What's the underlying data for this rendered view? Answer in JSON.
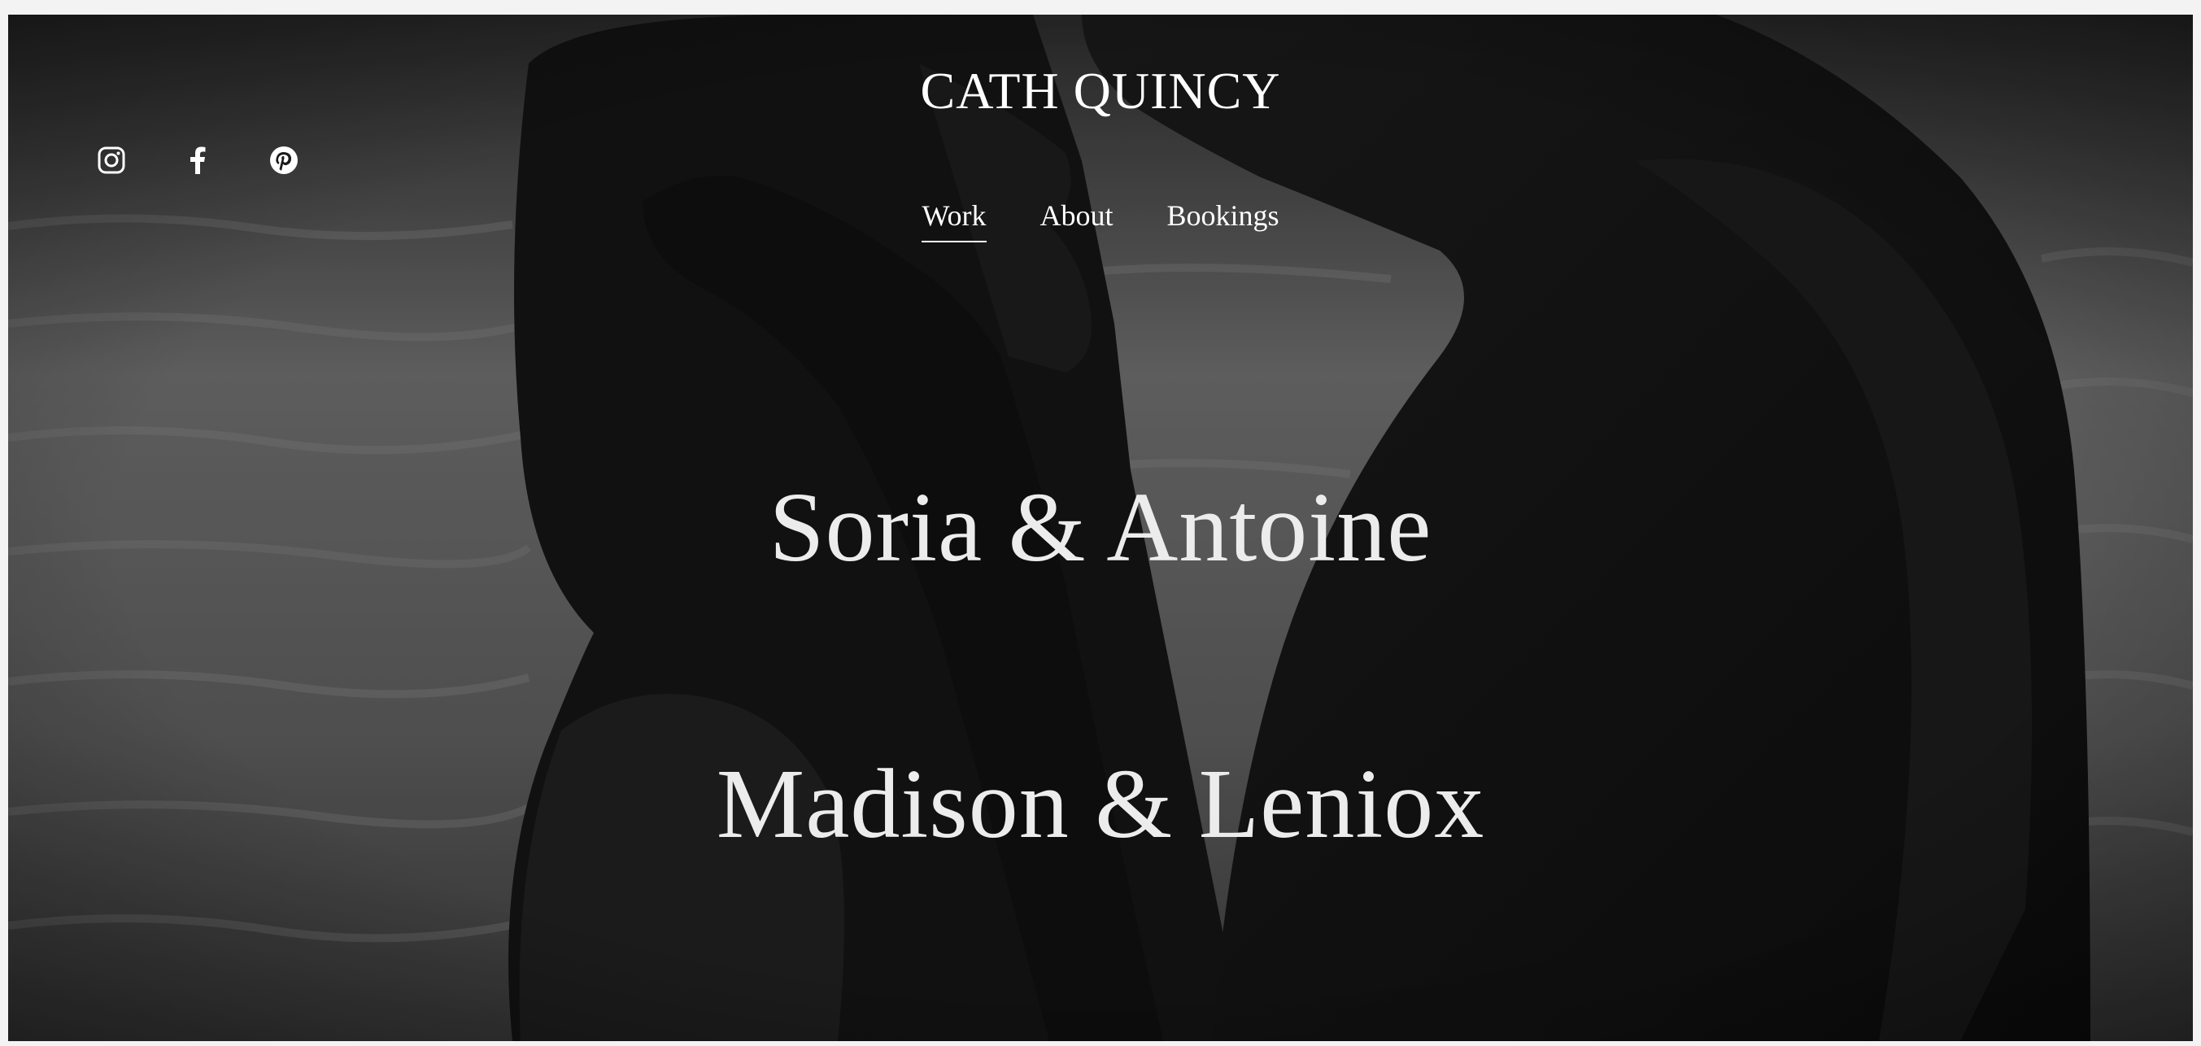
{
  "site": {
    "title": "CATH QUINCY"
  },
  "social": [
    {
      "name": "instagram-icon",
      "label": "Instagram"
    },
    {
      "name": "facebook-icon",
      "label": "Facebook"
    },
    {
      "name": "pinterest-icon",
      "label": "Pinterest"
    }
  ],
  "nav": {
    "items": [
      {
        "label": "Work",
        "active": true
      },
      {
        "label": "About",
        "active": false
      },
      {
        "label": "Bookings",
        "active": false
      }
    ]
  },
  "projects": [
    {
      "title": "Soria & Antoine"
    },
    {
      "title": "Madison & Leniox"
    }
  ],
  "colors": {
    "text": "#ffffff",
    "project_text": "#ececec",
    "page_border": "#f3f3f3"
  }
}
